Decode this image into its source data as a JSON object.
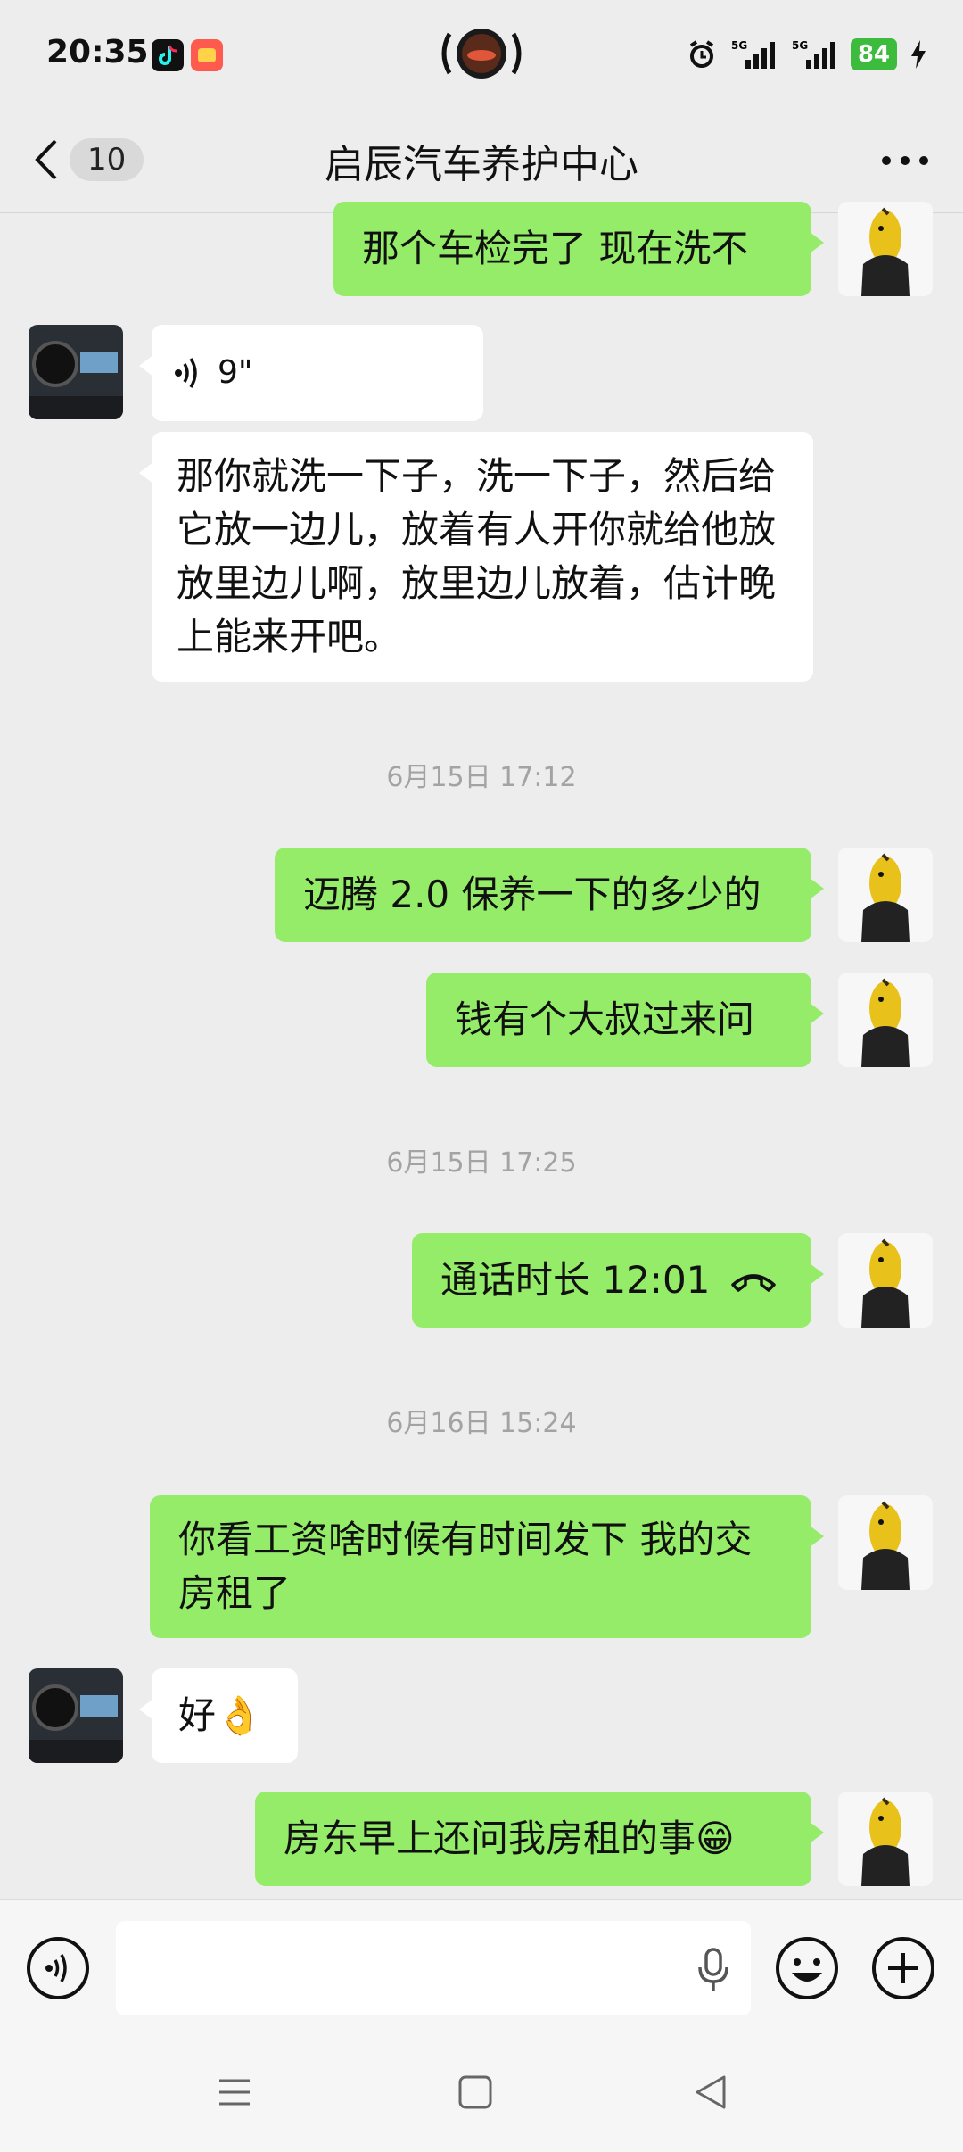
{
  "status_bar": {
    "time": "20:35",
    "battery": "84"
  },
  "header": {
    "unread_count": "10",
    "title": "启辰汽车养护中心"
  },
  "messages": [
    {
      "text": "那个车检完了 现在洗不"
    },
    {
      "voice_duration": "9\""
    },
    {
      "text": "那你就洗一下子，洗一下子，然后给它放一边儿，放着有人开你就给他放放里边儿啊，放里边儿放着，估计晚上能来开吧。"
    },
    {
      "timestamp": "6月15日 17:12"
    },
    {
      "text": "迈腾 2.0 保养一下的多少的"
    },
    {
      "text": "钱有个大叔过来问"
    },
    {
      "timestamp": "6月15日 17:25"
    },
    {
      "text": "通话时长 12:01"
    },
    {
      "timestamp": "6月16日 15:24"
    },
    {
      "text": "你看工资啥时候有时间发下 我的交房租了"
    },
    {
      "text": "好👌"
    },
    {
      "text": "房东早上还问我房租的事😁"
    }
  ],
  "icons": {
    "back": "chevron-left-icon",
    "more": "more-dots-icon",
    "voice": "voice-wave-icon",
    "mic": "microphone-icon",
    "emoji": "emoji-icon",
    "plus": "plus-icon",
    "hangup": "phone-hangup-icon"
  },
  "colors": {
    "my_bubble": "#95ec69",
    "other_bubble": "#ffffff",
    "background": "#ededed"
  }
}
